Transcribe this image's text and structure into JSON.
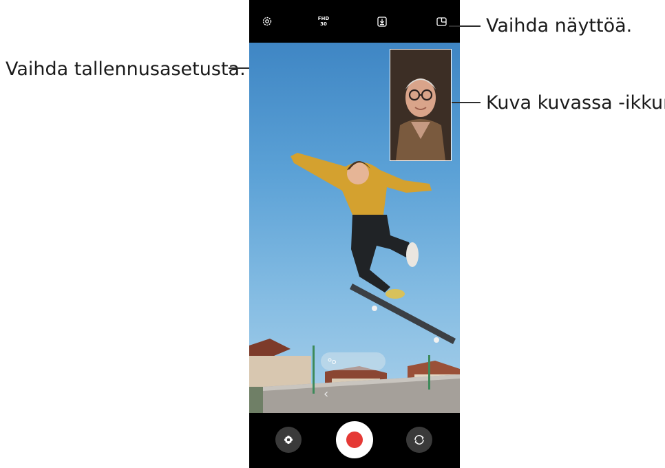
{
  "callouts": {
    "switch_screen": "Vaihda näyttöä.",
    "recording_setting": "Vaihda tallennusasetusta.",
    "pip_window": "Kuva kuvassa -ikkuna"
  },
  "top_bar": {
    "resolution_line1": "FHD",
    "resolution_line2": "30",
    "icons": [
      "settings-icon",
      "resolution",
      "save-option-icon",
      "switch-view-icon"
    ]
  },
  "bottom_bar": {
    "icons": [
      "effects-icon",
      "record-button",
      "switch-camera-icon"
    ]
  },
  "colors": {
    "record": "#e53935",
    "bar": "#000000",
    "sky_top": "#3f86c4",
    "sky_bottom": "#a9d0ea"
  }
}
